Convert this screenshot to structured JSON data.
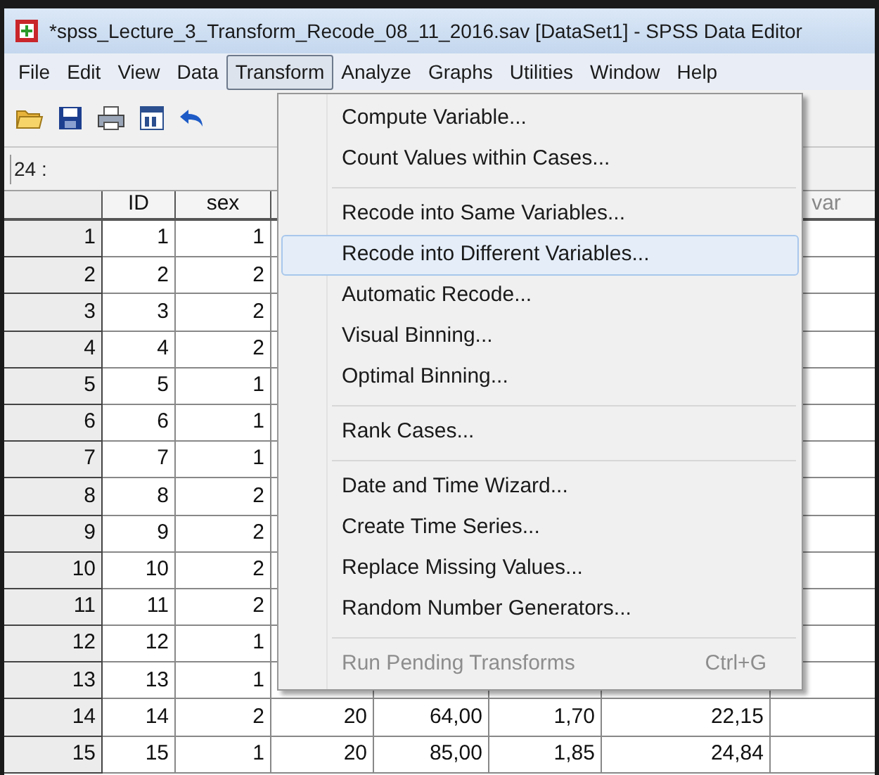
{
  "window": {
    "title": "*spss_Lecture_3_Transform_Recode_08_11_2016.sav [DataSet1] - SPSS Data Editor"
  },
  "menu_bar": [
    {
      "label": "File",
      "selected": false
    },
    {
      "label": "Edit",
      "selected": false
    },
    {
      "label": "View",
      "selected": false
    },
    {
      "label": "Data",
      "selected": false
    },
    {
      "label": "Transform",
      "selected": true
    },
    {
      "label": "Analyze",
      "selected": false
    },
    {
      "label": "Graphs",
      "selected": false
    },
    {
      "label": "Utilities",
      "selected": false
    },
    {
      "label": "Window",
      "selected": false
    },
    {
      "label": "Help",
      "selected": false
    }
  ],
  "toolbar": [
    {
      "kind": "open"
    },
    {
      "kind": "save"
    },
    {
      "kind": "print"
    },
    {
      "kind": "dialog"
    },
    {
      "kind": "undo"
    }
  ],
  "cell_editor": {
    "label": "24 :"
  },
  "table": {
    "columns": [
      {
        "label": "ID"
      },
      {
        "label": "sex"
      },
      {},
      {},
      {},
      {},
      {
        "label": "var"
      }
    ],
    "rows": [
      {
        "number": "1",
        "cells": [
          "1",
          "1"
        ]
      },
      {
        "number": "2",
        "cells": [
          "2",
          "2"
        ]
      },
      {
        "number": "3",
        "cells": [
          "3",
          "2"
        ]
      },
      {
        "number": "4",
        "cells": [
          "4",
          "2"
        ]
      },
      {
        "number": "5",
        "cells": [
          "5",
          "1"
        ]
      },
      {
        "number": "6",
        "cells": [
          "6",
          "1"
        ]
      },
      {
        "number": "7",
        "cells": [
          "7",
          "1"
        ]
      },
      {
        "number": "8",
        "cells": [
          "8",
          "2"
        ]
      },
      {
        "number": "9",
        "cells": [
          "9",
          "2"
        ]
      },
      {
        "number": "10",
        "cells": [
          "10",
          "2"
        ]
      },
      {
        "number": "11",
        "cells": [
          "11",
          "2"
        ]
      },
      {
        "number": "12",
        "cells": [
          "12",
          "1"
        ]
      },
      {
        "number": "13",
        "cells": [
          "13",
          "1"
        ]
      },
      {
        "number": "14",
        "cells": [
          "14",
          "2",
          "20",
          "64,00",
          "1,70",
          "22,15"
        ]
      },
      {
        "number": "15",
        "cells": [
          "15",
          "1",
          "20",
          "85,00",
          "1,85",
          "24,84"
        ]
      }
    ]
  },
  "transform_menu": {
    "items": [
      {
        "kind": "item",
        "label": "Compute Variable...",
        "highlighted": false,
        "disabled": false
      },
      {
        "kind": "item",
        "label": "Count Values within Cases...",
        "highlighted": false,
        "disabled": false
      },
      {
        "kind": "separator"
      },
      {
        "kind": "item",
        "label": "Recode into Same Variables...",
        "highlighted": false,
        "disabled": false
      },
      {
        "kind": "item",
        "label": "Recode into Different Variables...",
        "highlighted": true,
        "disabled": false
      },
      {
        "kind": "item",
        "label": "Automatic Recode...",
        "highlighted": false,
        "disabled": false
      },
      {
        "kind": "item",
        "label": "Visual Binning...",
        "highlighted": false,
        "disabled": false
      },
      {
        "kind": "item",
        "label": "Optimal Binning...",
        "highlighted": false,
        "disabled": false
      },
      {
        "kind": "separator"
      },
      {
        "kind": "item",
        "label": "Rank Cases...",
        "highlighted": false,
        "disabled": false
      },
      {
        "kind": "separator"
      },
      {
        "kind": "item",
        "label": "Date and Time Wizard...",
        "highlighted": false,
        "disabled": false
      },
      {
        "kind": "item",
        "label": "Create Time Series...",
        "highlighted": false,
        "disabled": false
      },
      {
        "kind": "item",
        "label": "Replace Missing Values...",
        "highlighted": false,
        "disabled": false
      },
      {
        "kind": "item",
        "label": "Random Number Generators...",
        "highlighted": false,
        "disabled": false
      },
      {
        "kind": "separator"
      },
      {
        "kind": "item",
        "label": "Run Pending Transforms",
        "shortcut": "Ctrl+G",
        "highlighted": false,
        "disabled": true
      }
    ]
  }
}
